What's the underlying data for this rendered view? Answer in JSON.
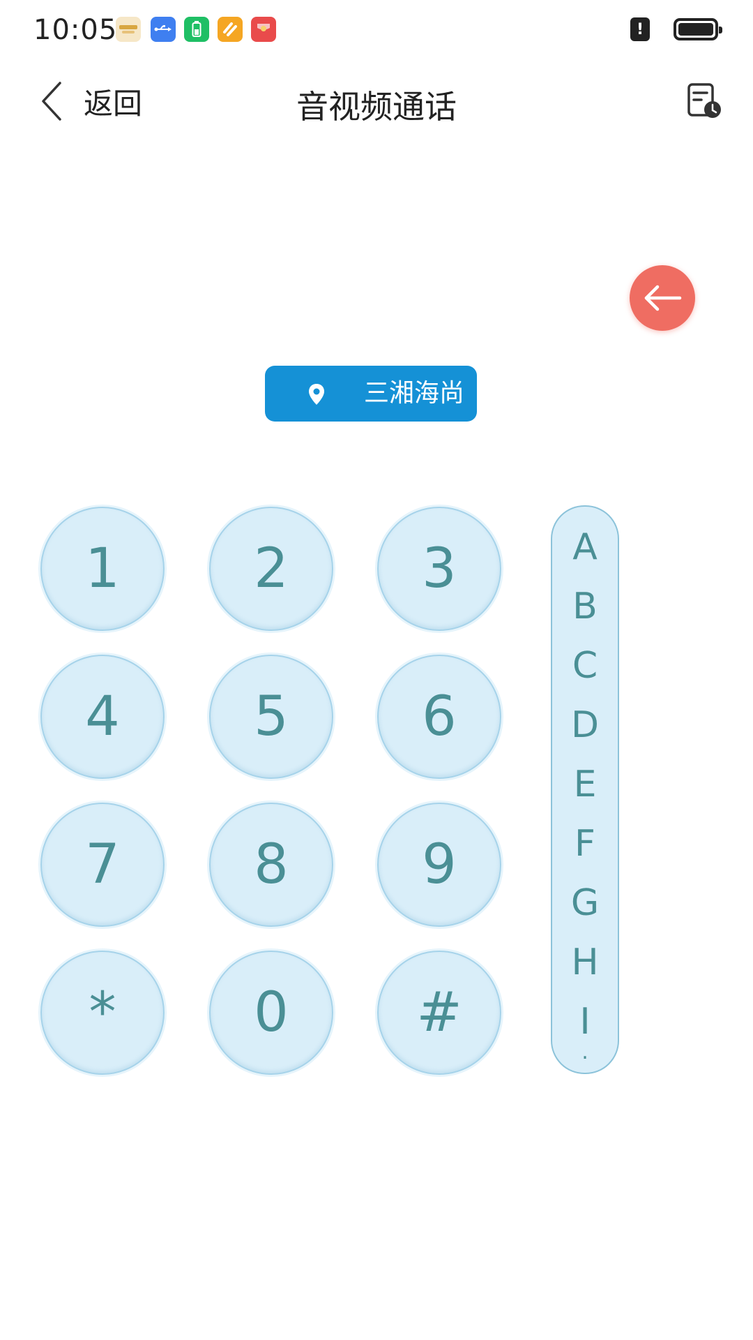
{
  "status_bar": {
    "time": "10:05",
    "notifications": [
      "app-icon",
      "usb-icon",
      "battery-saver-icon",
      "orange-app-icon",
      "red-envelope-icon"
    ],
    "alert": "!"
  },
  "header": {
    "back_label": "返回",
    "title": "音视频通话"
  },
  "location": {
    "text": "三湘海尚"
  },
  "keypad": {
    "keys": [
      "1",
      "2",
      "3",
      "4",
      "5",
      "6",
      "7",
      "8",
      "9",
      "*",
      "0",
      "#"
    ]
  },
  "alphabet": {
    "letters": [
      "A",
      "B",
      "C",
      "D",
      "E",
      "F",
      "G",
      "H",
      "I",
      "."
    ]
  },
  "colors": {
    "accent": "#1591d6",
    "delete": "#ef6d62",
    "key_bg": "#d9eef9",
    "key_text": "#4a8f95"
  }
}
